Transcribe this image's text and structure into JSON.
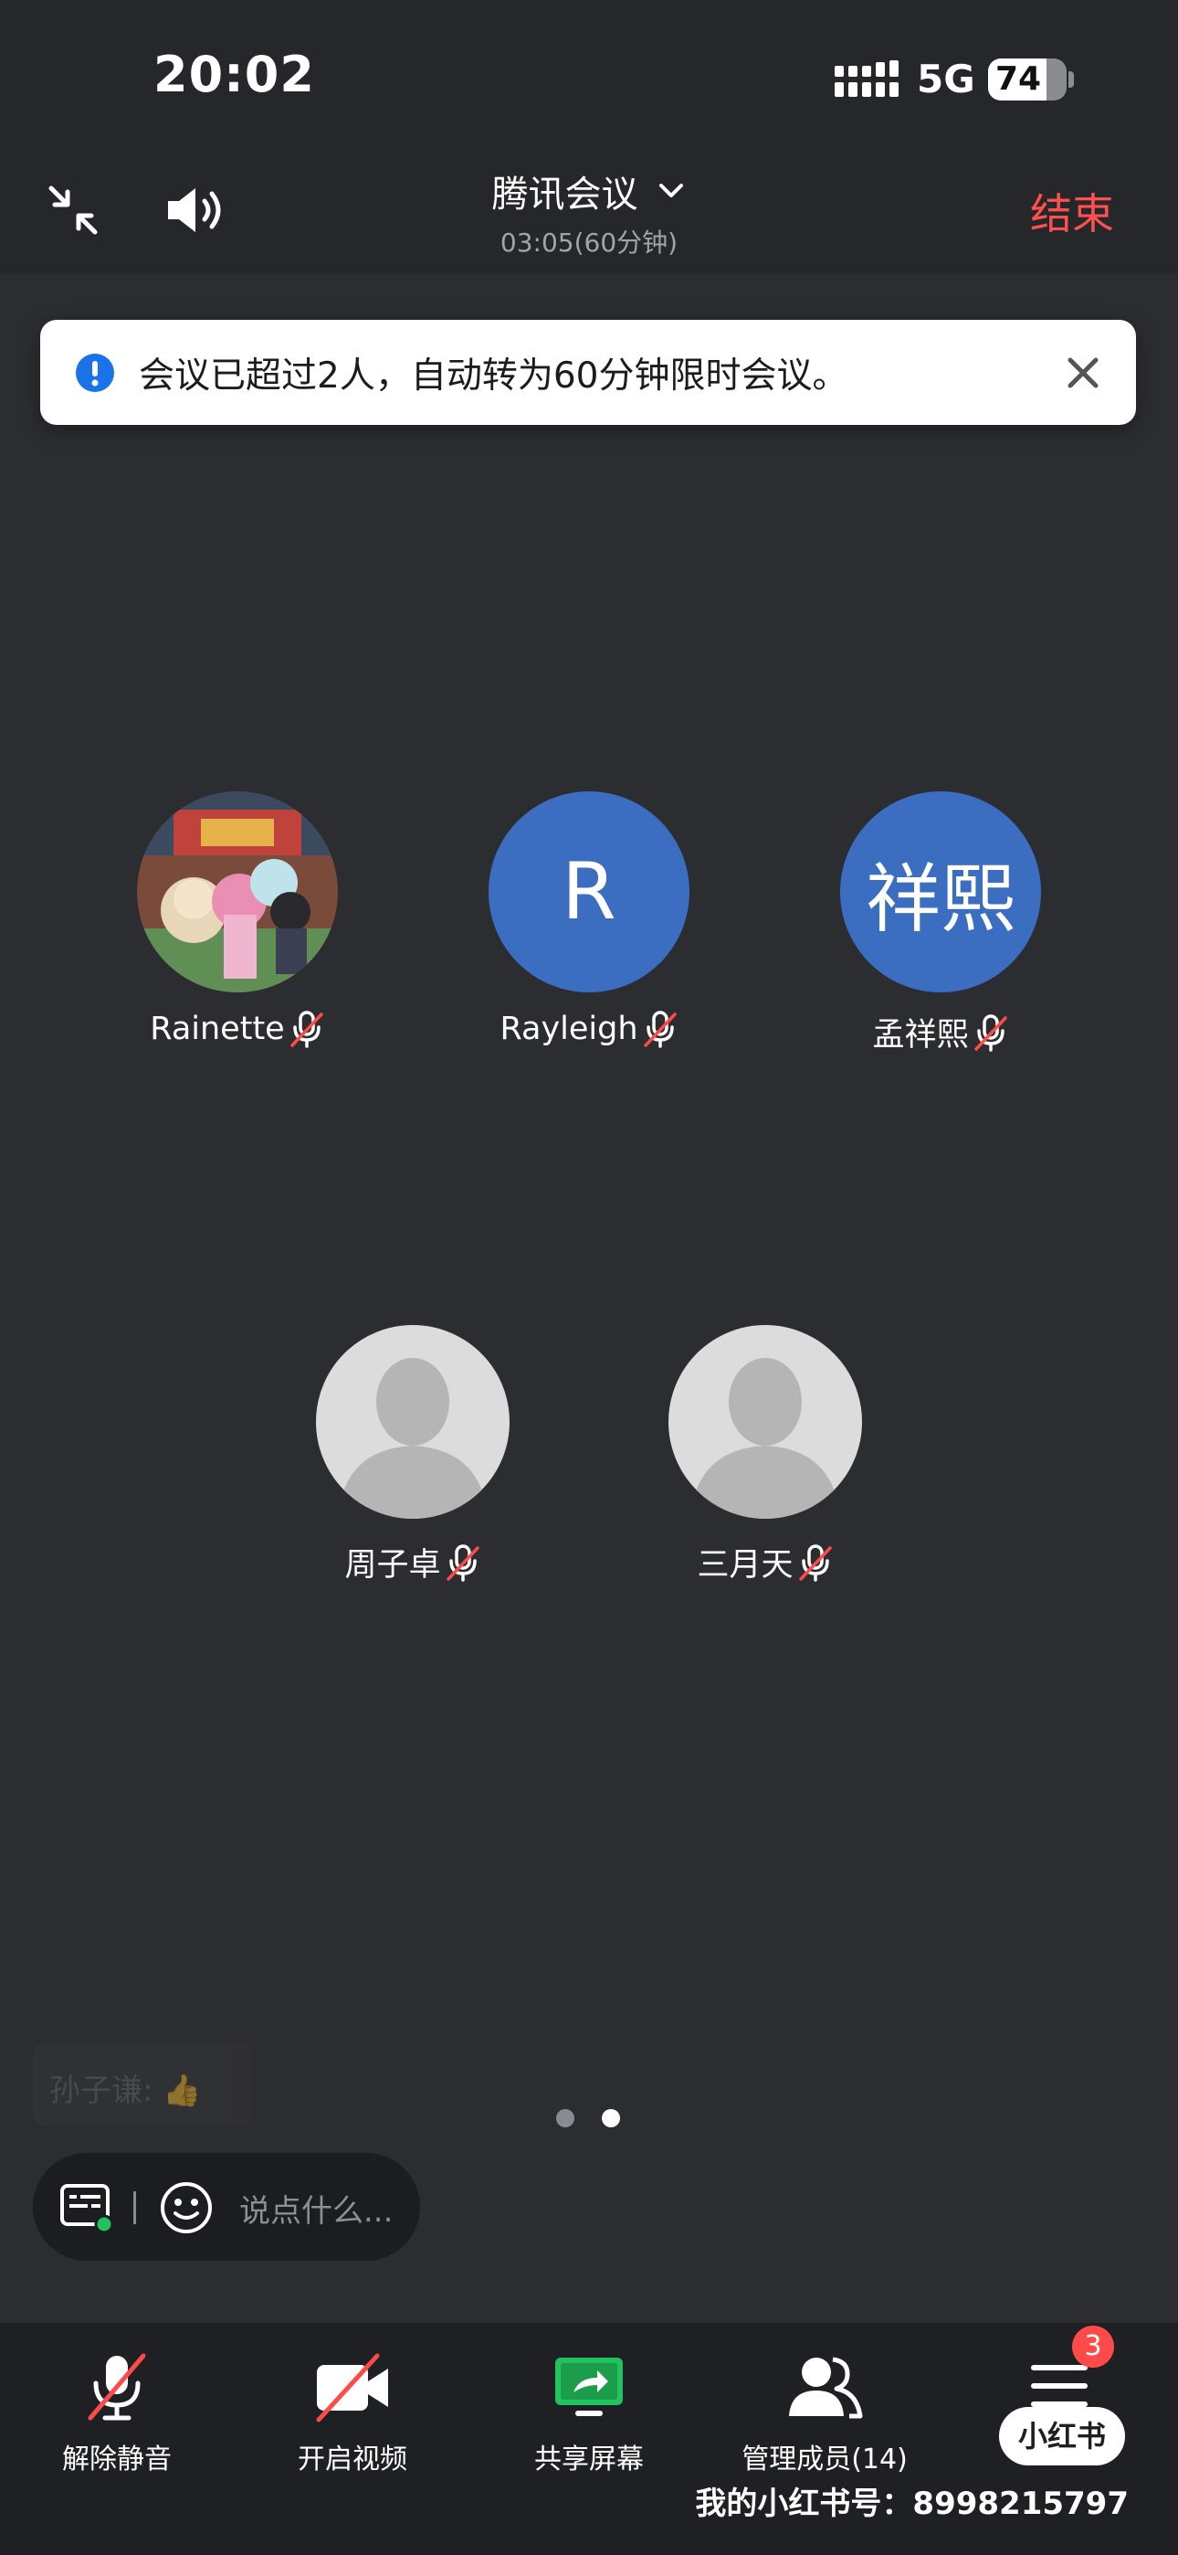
{
  "status_bar": {
    "time": "20:02",
    "network": "5G",
    "battery": "74",
    "battery_level": 0.74
  },
  "header": {
    "title": "腾讯会议",
    "subtitle": "03:05(60分钟)",
    "end_label": "结束"
  },
  "banner": {
    "text": "会议已超过2人，自动转为60分钟限时会议。"
  },
  "participants": [
    {
      "name": "Rainette",
      "avatar": "image",
      "muted": true
    },
    {
      "name": "Rayleigh",
      "avatar_text": "R",
      "muted": true
    },
    {
      "name": "孟祥熙",
      "avatar_text": "祥熙",
      "muted": true
    },
    {
      "name": "周子卓",
      "avatar": "default",
      "muted": true
    },
    {
      "name": "三月天",
      "avatar": "default",
      "muted": true
    }
  ],
  "pager": {
    "count": 2,
    "active_index": 1
  },
  "chat": {
    "placeholder": "说点什么...",
    "faded_message": "孙子谦: 👍"
  },
  "toolbar": {
    "unmute_label": "解除静音",
    "video_label": "开启视频",
    "share_label": "共享屏幕",
    "members_label": "管理成员(14)",
    "more_badge": "3"
  },
  "overlay": {
    "logo_text": "小红书",
    "watermark": "我的小红书号：8998215797"
  },
  "colors": {
    "background": "#2c2d31",
    "end": "#ff5050",
    "avatar_blue": "#3b6dc0",
    "share_green": "#22c35e",
    "info_blue": "#1a73e8"
  }
}
